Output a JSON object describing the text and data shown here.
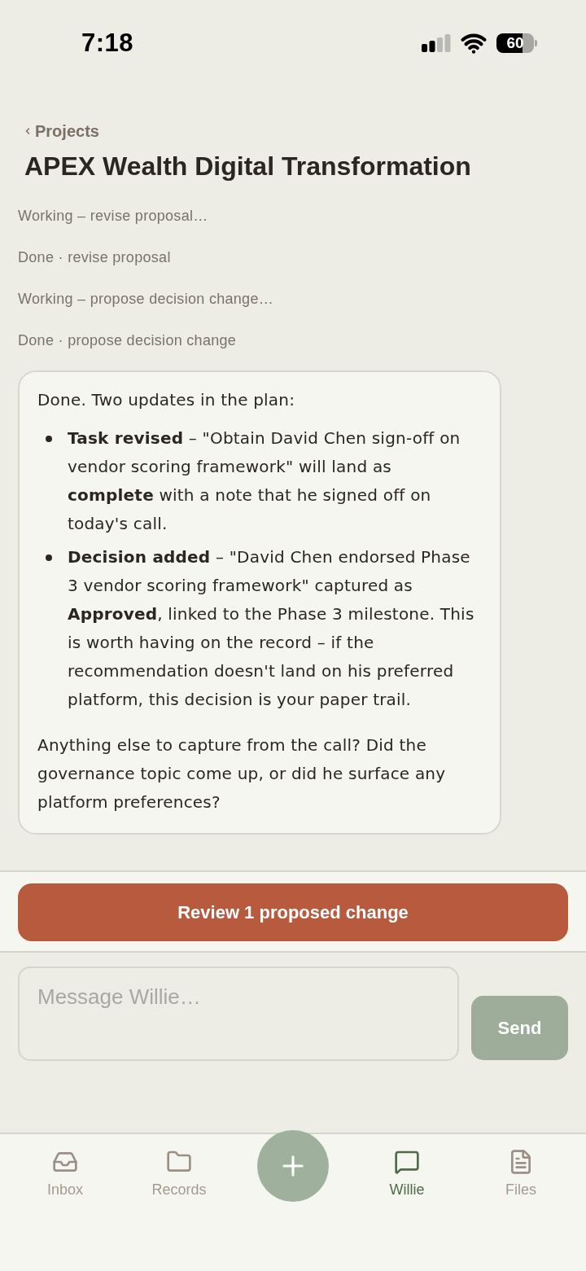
{
  "status_bar": {
    "time": "7:18",
    "battery": "60"
  },
  "header": {
    "back_label": "Projects",
    "title": "APEX Wealth Digital Transformation"
  },
  "activity": [
    "Working – revise proposal…",
    "Done · revise proposal",
    "Working – propose decision change…",
    "Done · propose decision change"
  ],
  "message": {
    "intro": "Done. Two updates in the plan:",
    "bullets": [
      "**Task revised** – \"Obtain David Chen sign-off on vendor scoring framework\" will land as **complete** with a note that he signed off on today's call.",
      "**Decision added** – \"David Chen endorsed Phase 3 vendor scoring framework\" captured as **Approved**, linked to the Phase 3 milestone. This is worth having on the record – if the recommendation doesn't land on his preferred platform, this decision is your paper trail."
    ],
    "outro": "Anything else to capture from the call? Did the governance topic come up, or did he surface any platform preferences?"
  },
  "proposal_button": "Review 1 proposed change",
  "composer": {
    "placeholder": "Message Willie…",
    "send_label": "Send"
  },
  "tab_bar": [
    {
      "kind": "tab",
      "label": "Inbox",
      "selected": false
    },
    {
      "kind": "tab",
      "label": "Records",
      "selected": false
    },
    {
      "kind": "action"
    },
    {
      "kind": "tab",
      "label": "Willie",
      "selected": true
    },
    {
      "kind": "tab",
      "label": "Files",
      "selected": false
    }
  ]
}
